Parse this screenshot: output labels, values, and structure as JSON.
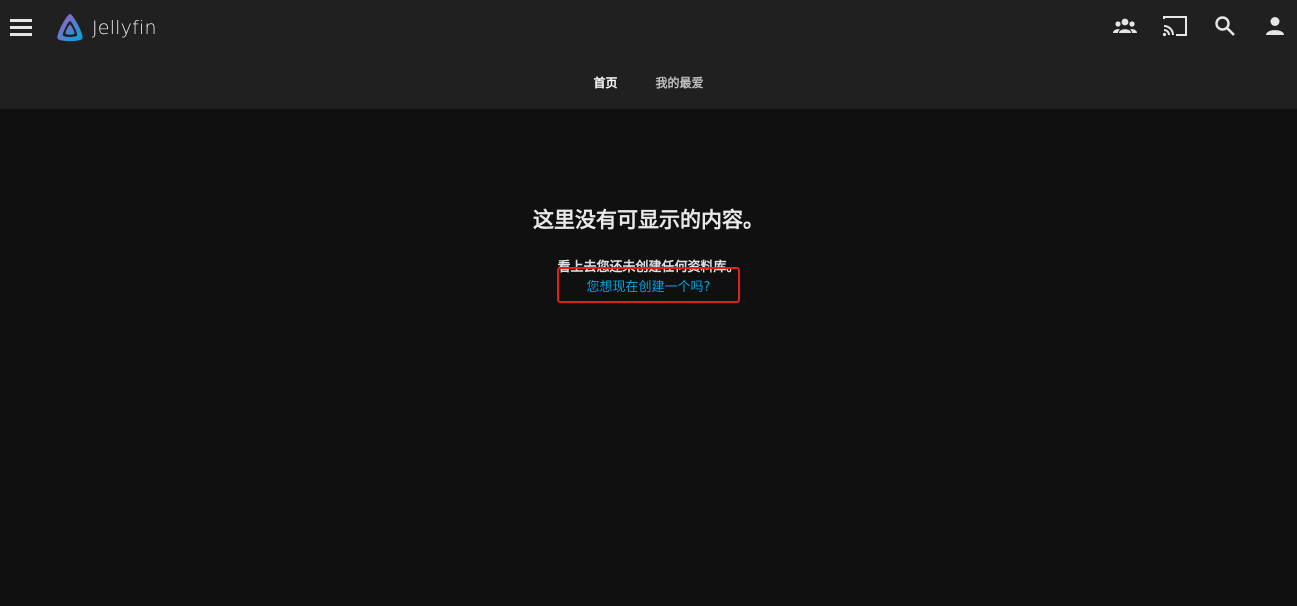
{
  "header": {
    "app_name": "Jellyfin",
    "icons": [
      "menu-icon",
      "jellyfin-logo-icon",
      "users-icon",
      "cast-icon",
      "search-icon",
      "user-icon"
    ]
  },
  "tabs": [
    {
      "label": "首页",
      "active": true
    },
    {
      "label": "我的最爱",
      "active": false
    }
  ],
  "empty_state": {
    "title": "这里没有可显示的内容。",
    "message": "看上去您还未创建任何资料库。",
    "link": "您想现在创建一个吗?"
  },
  "colors": {
    "header_bg": "#202020",
    "page_bg": "#101010",
    "accent": "#00a4dc",
    "highlight": "#e02020"
  }
}
